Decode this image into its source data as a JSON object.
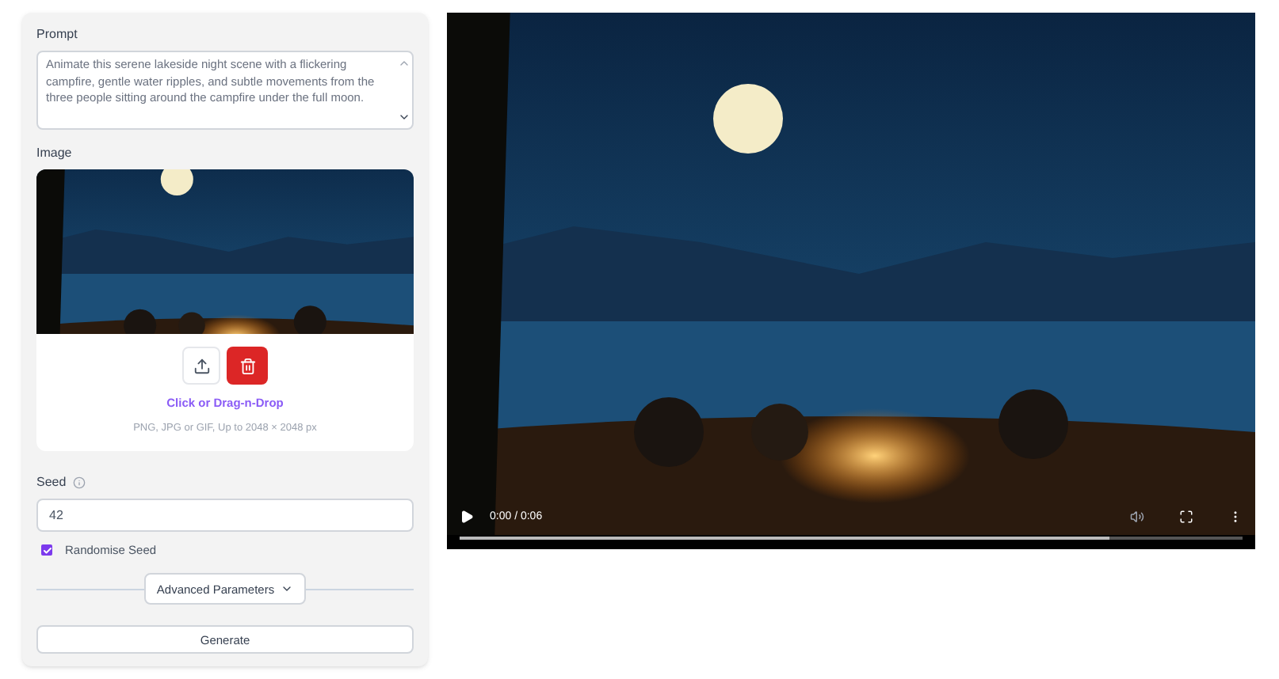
{
  "prompt": {
    "label": "Prompt",
    "value": "Animate this serene lakeside night scene with a flickering campfire, gentle water ripples, and subtle movements from the three people sitting around the campfire under the full moon."
  },
  "image": {
    "label": "Image",
    "upload_link": "Click or Drag-n-Drop",
    "hint": "PNG, JPG or GIF, Up to 2048 × 2048 px"
  },
  "seed": {
    "label": "Seed",
    "value": "42"
  },
  "randomise": {
    "label": "Randomise Seed",
    "checked": true
  },
  "advanced": {
    "label": "Advanced Parameters"
  },
  "generate": {
    "label": "Generate"
  },
  "video": {
    "time": "0:00 / 0:06",
    "buffered": {
      "level": 0.83
    }
  }
}
